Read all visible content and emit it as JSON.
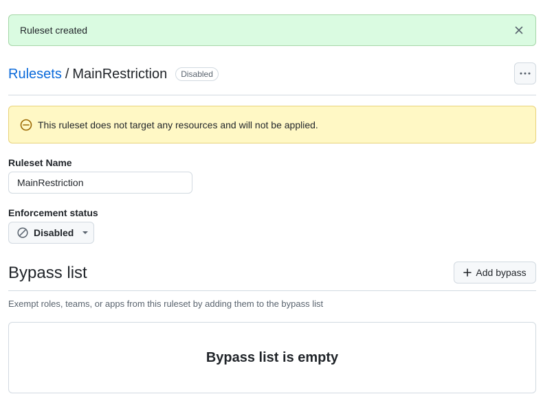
{
  "flash": {
    "message": "Ruleset created",
    "close_icon": "x-icon"
  },
  "breadcrumb": {
    "parent": "Rulesets",
    "separator": "/",
    "current": "MainRestriction"
  },
  "status_badge": "Disabled",
  "warning": {
    "message": "This ruleset does not target any resources and will not be applied.",
    "icon": "circle-slash-icon"
  },
  "form": {
    "ruleset_name_label": "Ruleset Name",
    "ruleset_name_value": "MainRestriction",
    "enforcement_label": "Enforcement status",
    "enforcement_value": "Disabled"
  },
  "bypass": {
    "title": "Bypass list",
    "add_button": "Add bypass",
    "description": "Exempt roles, teams, or apps from this ruleset by adding them to the bypass list",
    "empty_message": "Bypass list is empty"
  },
  "colors": {
    "accent": "#0969da",
    "flash_bg": "#dafbe1",
    "warning_bg": "#fff8c5"
  }
}
